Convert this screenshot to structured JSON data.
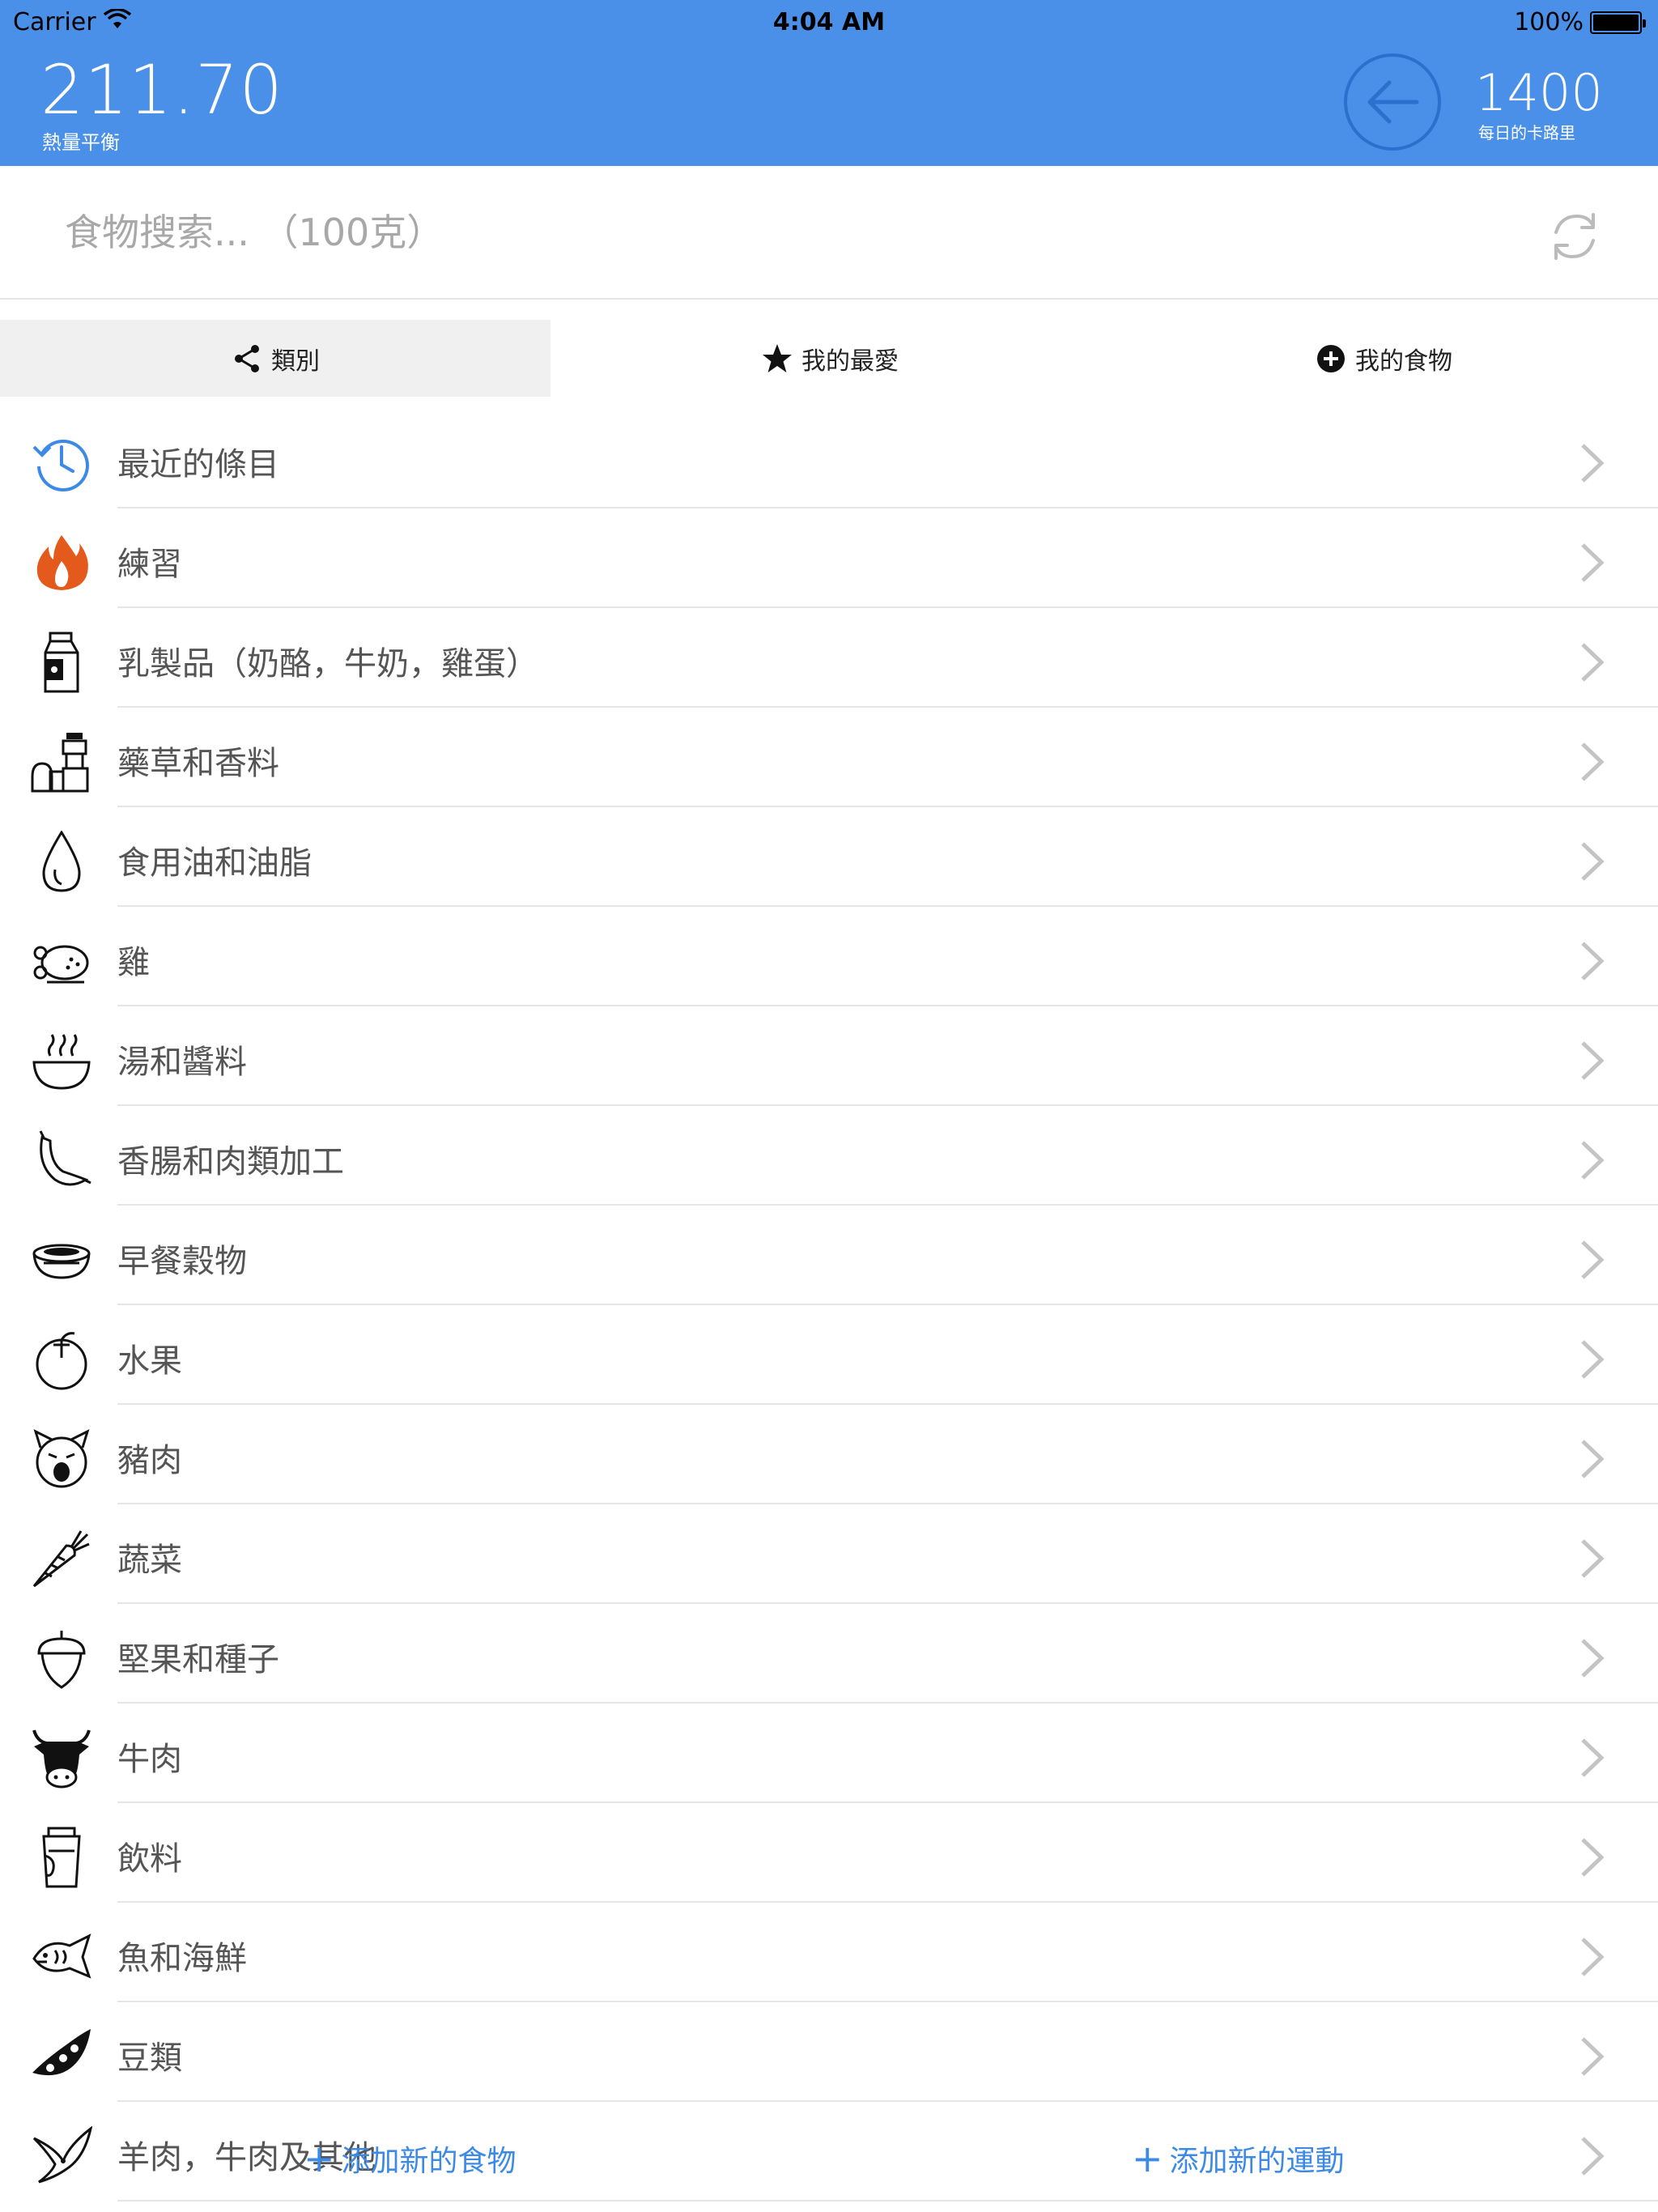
{
  "status_bar": {
    "carrier": "Carrier",
    "time": "4:04 AM",
    "battery": "100%"
  },
  "header": {
    "balance_value": "211.70",
    "balance_label": "熱量平衡",
    "daily_value": "1400",
    "daily_label": "每日的卡路里",
    "background_color": "#4a90e8"
  },
  "search": {
    "placeholder": "食物搜索... （100克）"
  },
  "tabs": [
    {
      "label": "類別",
      "icon": "share-icon",
      "active": true
    },
    {
      "label": "我的最愛",
      "icon": "star-icon",
      "active": false
    },
    {
      "label": "我的食物",
      "icon": "plus-circle-icon",
      "active": false
    }
  ],
  "categories": [
    {
      "label": "最近的條目",
      "icon": "clock-history-icon"
    },
    {
      "label": "練習",
      "icon": "flame-icon"
    },
    {
      "label": "乳製品（奶酪，牛奶，雞蛋）",
      "icon": "milk-carton-icon"
    },
    {
      "label": "藥草和香料",
      "icon": "spice-grinder-icon"
    },
    {
      "label": "食用油和油脂",
      "icon": "oil-drop-icon"
    },
    {
      "label": "雞",
      "icon": "roast-chicken-icon"
    },
    {
      "label": "湯和醬料",
      "icon": "soup-bowl-icon"
    },
    {
      "label": "香腸和肉類加工",
      "icon": "sausage-icon"
    },
    {
      "label": "早餐穀物",
      "icon": "cereal-bowl-icon"
    },
    {
      "label": "水果",
      "icon": "fruit-icon"
    },
    {
      "label": "豬肉",
      "icon": "pig-icon"
    },
    {
      "label": "蔬菜",
      "icon": "carrot-icon"
    },
    {
      "label": "堅果和種子",
      "icon": "acorn-icon"
    },
    {
      "label": "牛肉",
      "icon": "cow-icon"
    },
    {
      "label": "飲料",
      "icon": "cup-icon"
    },
    {
      "label": "魚和海鮮",
      "icon": "fish-icon"
    },
    {
      "label": "豆類",
      "icon": "pea-pod-icon"
    },
    {
      "label": "羊肉，牛肉及其他",
      "icon": "bird-icon"
    }
  ],
  "actions": {
    "add_food": "添加新的食物",
    "add_exercise": "添加新的運動"
  },
  "accent_color": "#3d8ae6"
}
